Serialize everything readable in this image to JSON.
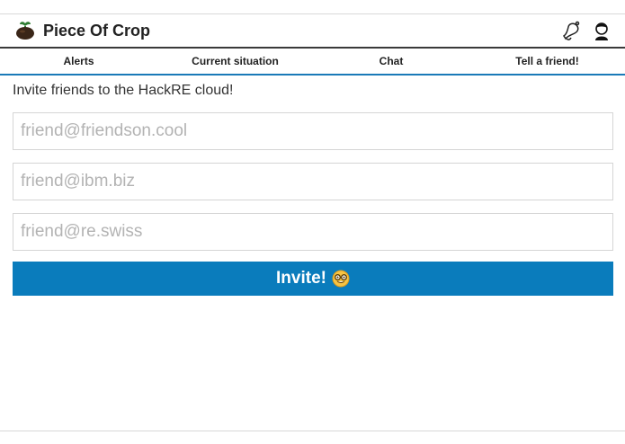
{
  "app": {
    "title": "Piece Of Crop",
    "logo_icon": "plant-sprout-icon",
    "actions": [
      {
        "icon": "bell-icon"
      },
      {
        "icon": "user-avatar-icon"
      }
    ]
  },
  "tabs": [
    {
      "label": "Alerts"
    },
    {
      "label": "Current situation"
    },
    {
      "label": "Chat"
    },
    {
      "label": "Tell a friend!",
      "active": true
    }
  ],
  "invite": {
    "heading": "Invite friends to the HackRE cloud!",
    "fields": [
      {
        "placeholder": "friend@friendson.cool",
        "value": ""
      },
      {
        "placeholder": "friend@ibm.biz",
        "value": ""
      },
      {
        "placeholder": "friend@re.swiss",
        "value": ""
      }
    ],
    "button_label": "Invite!",
    "button_emoji": "nerd-face-emoji-icon"
  },
  "colors": {
    "accent": "#0a7cbc",
    "header_rule": "#3a3a3a",
    "tab_rule": "#1a7ab8"
  }
}
